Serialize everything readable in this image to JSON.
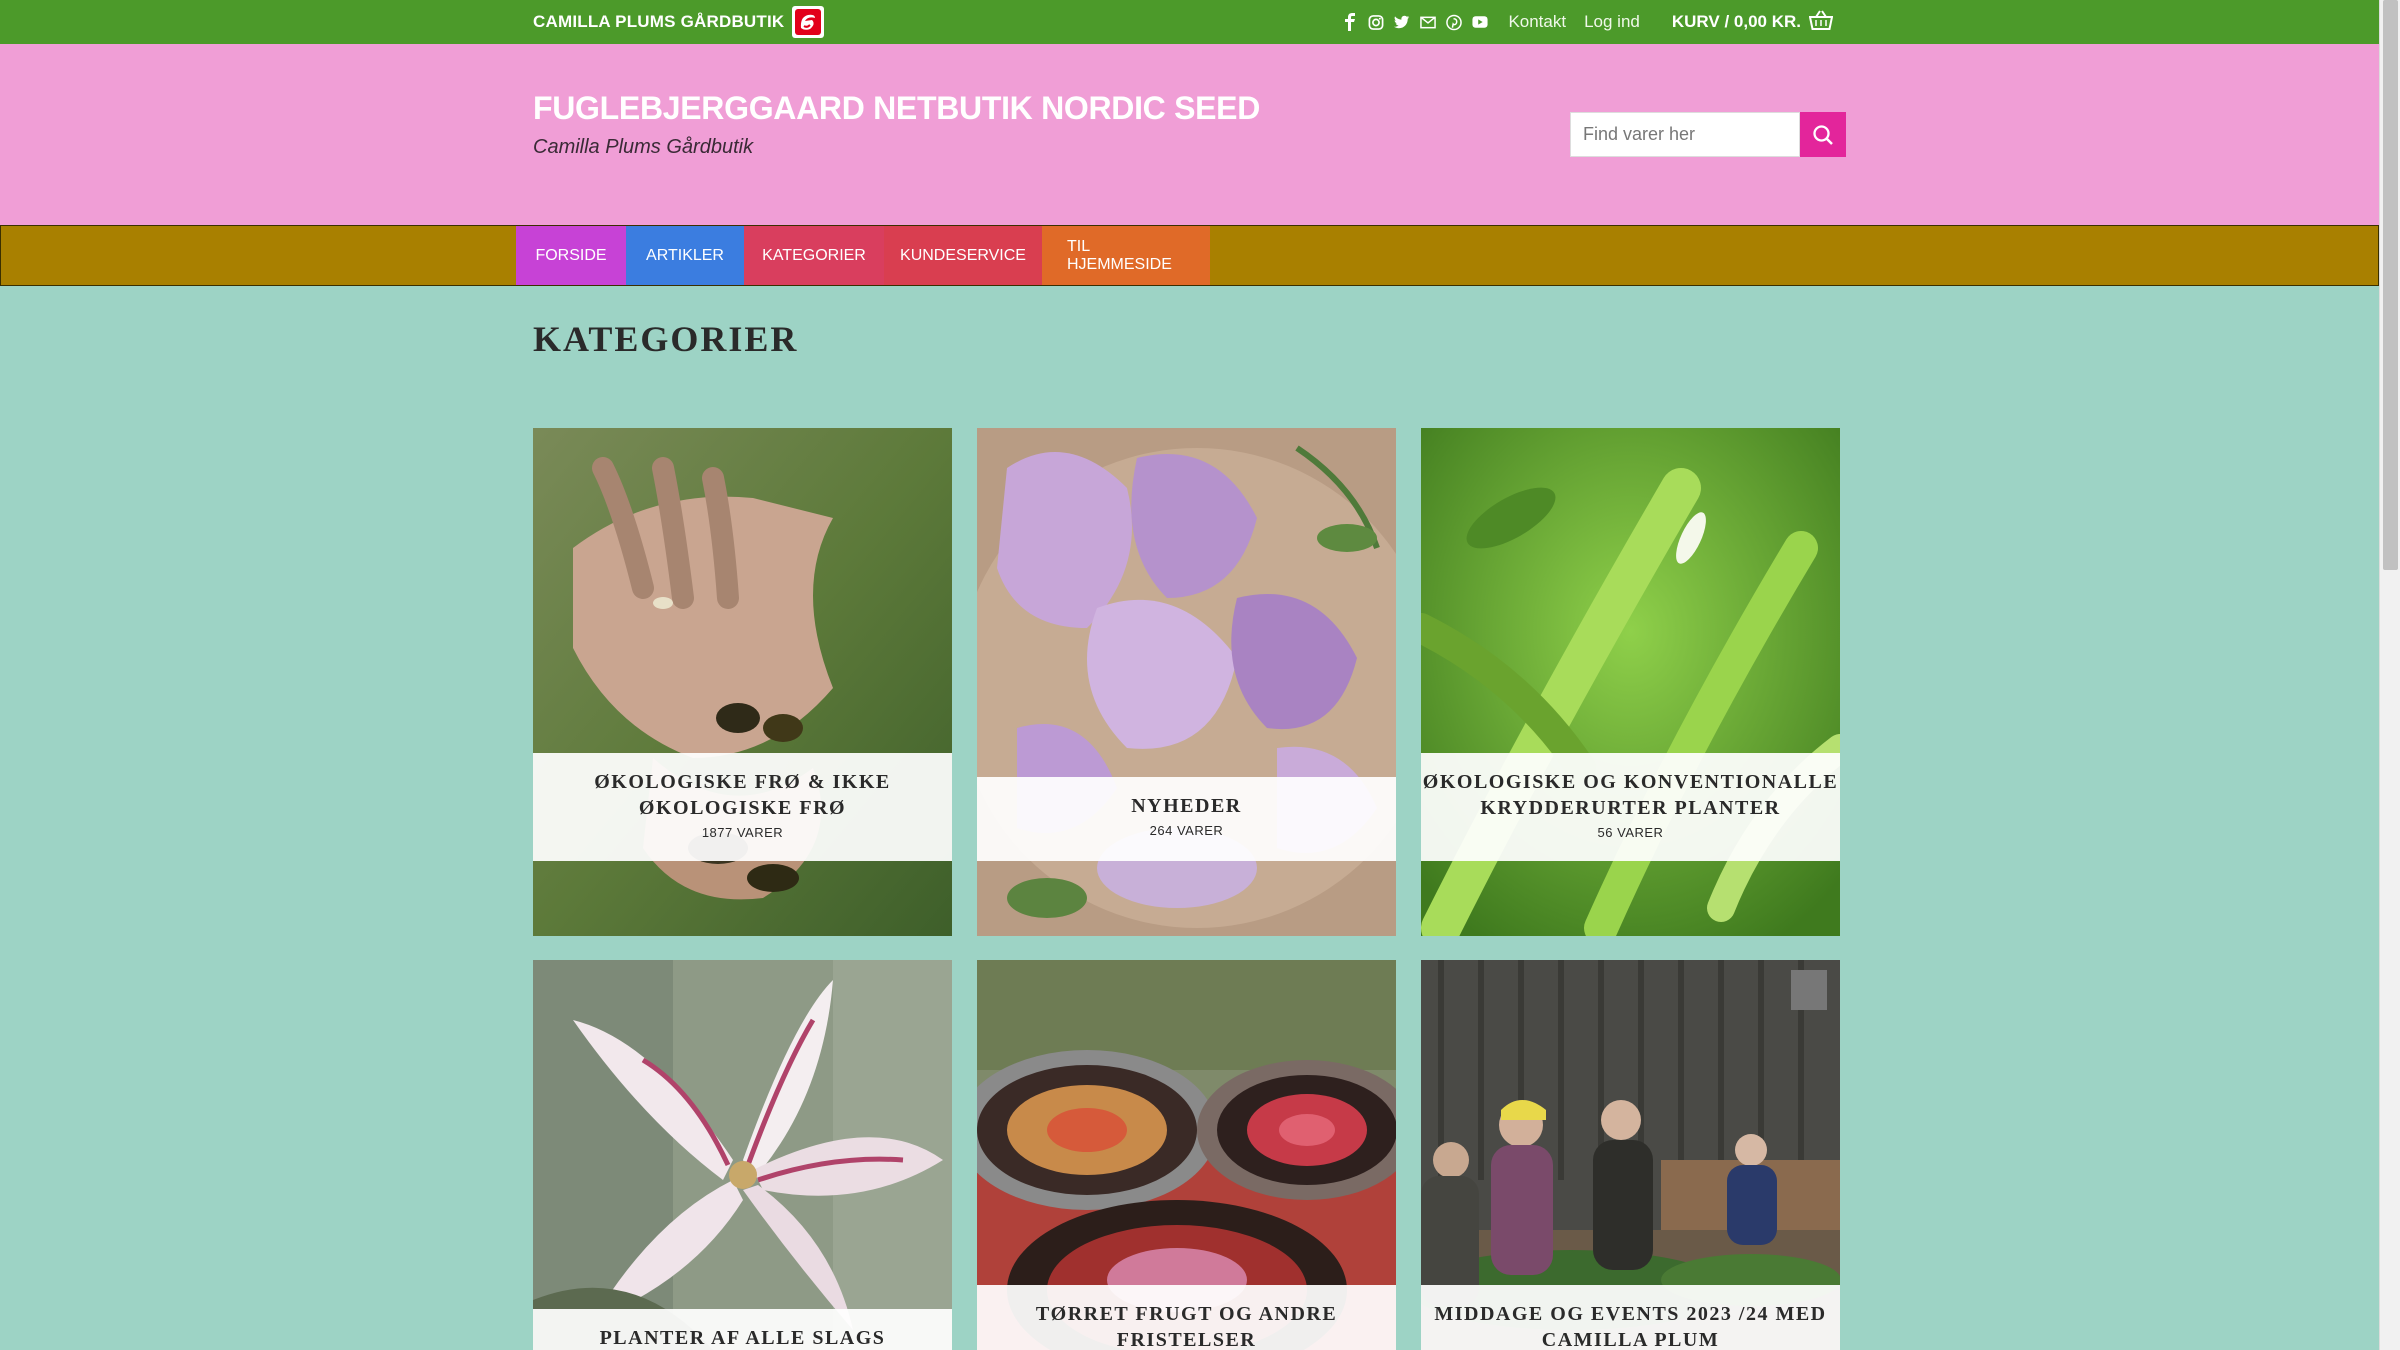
{
  "topbar": {
    "brand": "CAMILLA PLUMS GÅRDBUTIK",
    "links": [
      "Kontakt",
      "Log ind"
    ],
    "cart_label": "KURV / 0,00 KR.",
    "social_icons": [
      "facebook-icon",
      "instagram-icon",
      "twitter-icon",
      "email-icon",
      "pinterest-icon",
      "youtube-icon"
    ]
  },
  "header": {
    "site_title": "FUGLEBJERGGAARD NETBUTIK NORDIC SEED",
    "tagline": "Camilla Plums Gårdbutik",
    "search_placeholder": "Find varer her"
  },
  "nav": {
    "items": [
      {
        "label": "FORSIDE",
        "color": "#c742d6"
      },
      {
        "label": "ARTIKLER",
        "color": "#3b7de0"
      },
      {
        "label": "KATEGORIER",
        "color": "#d93e5e"
      },
      {
        "label": "KUNDESERVICE",
        "color": "#d93e50"
      },
      {
        "label": "TIL HJEMMESIDE",
        "color": "#e06a28"
      }
    ]
  },
  "main": {
    "title": "KATEGORIER",
    "categories": [
      {
        "name": "ØKOLOGISKE FRØ & IKKE ØKOLOGISKE FRØ",
        "count": "1877 VARER"
      },
      {
        "name": "NYHEDER",
        "count": "264 VARER"
      },
      {
        "name": "ØKOLOGISKE OG KONVENTIONALLE KRYDDERURTER PLANTER",
        "count": "56 VARER"
      },
      {
        "name": "PLANTER AF ALLE SLAGS",
        "count": ""
      },
      {
        "name": "TØRRET FRUGT OG ANDRE FRISTELSER",
        "count": ""
      },
      {
        "name": "MIDDAGE OG EVENTS 2023 /24 MED CAMILLA PLUM",
        "count": ""
      }
    ]
  }
}
